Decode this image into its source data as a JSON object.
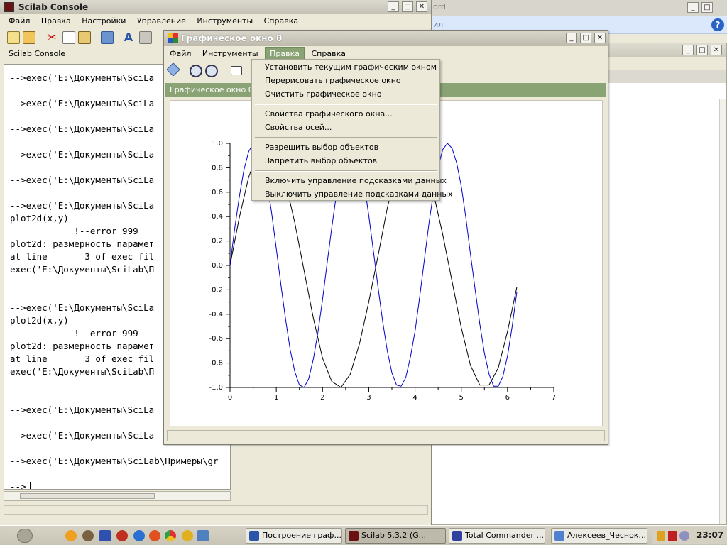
{
  "background_window": {
    "faded_title": "ord",
    "faded_menu": "ил"
  },
  "console": {
    "title": "Scilab Console",
    "menu": [
      "Файл",
      "Правка",
      "Настройки",
      "Управление",
      "Инструменты",
      "Справка"
    ],
    "label": "Scilab Console",
    "lines": [
      "-->exec('E:\\Документы\\SciLa",
      "",
      "-->exec('E:\\Документы\\SciLa",
      "",
      "-->exec('E:\\Документы\\SciLa",
      "",
      "-->exec('E:\\Документы\\SciLa",
      "",
      "-->exec('E:\\Документы\\SciLa",
      "",
      "-->exec('E:\\Документы\\SciLa",
      "plot2d(x,y)",
      "            !--error 999",
      "plot2d: размерность парамет",
      "at line       3 of exec fil",
      "exec('E:\\Документы\\SciLab\\П",
      "",
      "",
      "-->exec('E:\\Документы\\SciLa",
      "plot2d(x,y)",
      "            !--error 999",
      "plot2d: размерность парамет",
      "at line       3 of exec fil",
      "exec('E:\\Документы\\SciLab\\П",
      "",
      "",
      "-->exec('E:\\Документы\\SciLa",
      "",
      "-->exec('E:\\Документы\\SciLa",
      "",
      "-->exec('E:\\Документы\\SciLab\\Примеры\\gr",
      "",
      "-->"
    ]
  },
  "graphics_window": {
    "title": "Графическое окно 0",
    "menu": [
      "Файл",
      "Инструменты",
      "Правка",
      "Справка"
    ],
    "active_menu": "Правка",
    "canvas_label": "Графическое окно 0",
    "dropdown": {
      "group1": [
        "Установить текущим графическим окном",
        "Перерисовать графическое окно",
        "Очистить графическое окно"
      ],
      "group2": [
        "Свойства графического окна...",
        "Свойства осей..."
      ],
      "group3": [
        "Разрешить выбор объектов",
        "Запретить выбор объектов"
      ],
      "group4": [
        "Включить управление подсказками данных",
        "Выключить управление подсказками данных"
      ]
    }
  },
  "chart_data": {
    "type": "line",
    "xlim": [
      0,
      7
    ],
    "ylim": [
      -1.0,
      1.0
    ],
    "x_ticks": [
      "0",
      "1",
      "2",
      "3",
      "4",
      "5",
      "6",
      "7"
    ],
    "y_ticks": [
      "1.0",
      "0.8",
      "0.6",
      "0.4",
      "0.2",
      "0.0",
      "-0.2",
      "-0.4",
      "-0.6",
      "-0.8",
      "-1.0"
    ],
    "grid": false,
    "series": [
      {
        "color": "#000000",
        "x": [
          0,
          0.2,
          0.4,
          0.6,
          0.8,
          1.0,
          1.2,
          1.4,
          1.6,
          1.8,
          2.0,
          2.2,
          2.4,
          2.6,
          2.8,
          3.0,
          3.2,
          3.4,
          3.6,
          3.8,
          4.0,
          4.2,
          4.4,
          4.6,
          4.8,
          5.0,
          5.2,
          5.4,
          5.6,
          5.8,
          6.0,
          6.2
        ],
        "y": [
          0,
          0.39,
          0.72,
          0.93,
          1.0,
          0.91,
          0.68,
          0.35,
          -0.04,
          -0.43,
          -0.76,
          -0.95,
          -1.0,
          -0.89,
          -0.64,
          -0.3,
          0.08,
          0.47,
          0.79,
          0.96,
          0.99,
          0.86,
          0.59,
          0.25,
          -0.13,
          -0.51,
          -0.82,
          -0.98,
          -0.98,
          -0.84,
          -0.54,
          -0.18
        ]
      },
      {
        "color": "#0000cc",
        "x": [
          0,
          0.1,
          0.2,
          0.3,
          0.4,
          0.5,
          0.6,
          0.7,
          0.8,
          0.9,
          1.0,
          1.1,
          1.2,
          1.3,
          1.4,
          1.5,
          1.6,
          1.7,
          1.8,
          1.9,
          2.0,
          2.1,
          2.2,
          2.3,
          2.4,
          2.5,
          2.6,
          2.7,
          2.8,
          2.9,
          3.0,
          3.1,
          3.2,
          3.3,
          3.4,
          3.5,
          3.6,
          3.7,
          3.8,
          3.9,
          4.0,
          4.1,
          4.2,
          4.3,
          4.4,
          4.5,
          4.6,
          4.7,
          4.8,
          4.9,
          5.0,
          5.1,
          5.2,
          5.3,
          5.4,
          5.5,
          5.6,
          5.7,
          5.8,
          5.9,
          6.0,
          6.1,
          6.2
        ],
        "y": [
          0,
          0.3,
          0.56,
          0.78,
          0.93,
          1.0,
          0.97,
          0.86,
          0.68,
          0.43,
          0.14,
          -0.16,
          -0.44,
          -0.69,
          -0.87,
          -0.98,
          -1.0,
          -0.93,
          -0.77,
          -0.55,
          -0.28,
          0.02,
          0.31,
          0.58,
          0.79,
          0.94,
          1.0,
          0.97,
          0.85,
          0.67,
          0.41,
          0.12,
          -0.18,
          -0.46,
          -0.7,
          -0.88,
          -0.98,
          -0.99,
          -0.92,
          -0.75,
          -0.54,
          -0.26,
          0.04,
          0.34,
          0.6,
          0.81,
          0.95,
          1.0,
          0.96,
          0.84,
          0.65,
          0.39,
          0.09,
          -0.2,
          -0.48,
          -0.72,
          -0.89,
          -0.99,
          -0.99,
          -0.91,
          -0.74,
          -0.5,
          -0.22
        ]
      }
    ]
  },
  "taskbar": {
    "buttons": [
      "Построение граф...",
      "Scilab 5.3.2 (G...",
      "Total Commander ...",
      "Алексеев_Чеснок..."
    ],
    "clock": "23:07"
  }
}
